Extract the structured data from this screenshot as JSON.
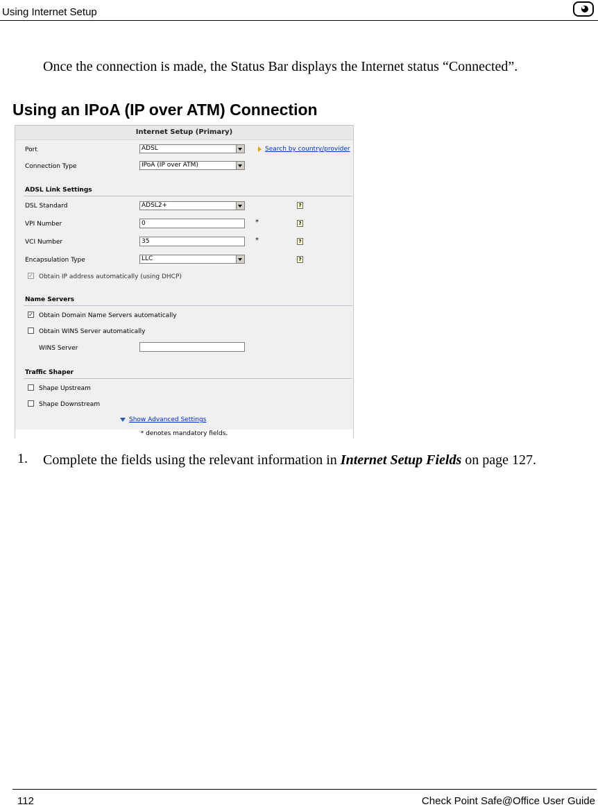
{
  "header": {
    "title": "Using Internet Setup",
    "icon": "device-icon"
  },
  "intro": "Once the connection is made, the Status Bar displays the Internet status “Connected”.",
  "section_title": "Using an IPoA (IP over ATM) Connection",
  "screenshot": {
    "panel_title": "Internet Setup (Primary)",
    "port": {
      "label": "Port",
      "value": "ADSL"
    },
    "search_link": "Search by country/provider",
    "connection_type": {
      "label": "Connection Type",
      "value": "IPoA (IP over ATM)"
    },
    "adsl_section": "ADSL Link Settings",
    "dsl_standard": {
      "label": "DSL Standard",
      "value": "ADSL2+"
    },
    "vpi": {
      "label": "VPI Number",
      "value": "0"
    },
    "vci": {
      "label": "VCI Number",
      "value": "35"
    },
    "encapsulation": {
      "label": "Encapsulation Type",
      "value": "LLC"
    },
    "mandatory_star": "*",
    "obtain_ip": "Obtain IP address automatically (using DHCP)",
    "name_servers_section": "Name Servers",
    "obtain_dns": "Obtain Domain Name Servers automatically",
    "obtain_wins": "Obtain WINS Server automatically",
    "wins_server": {
      "label": "WINS Server",
      "value": ""
    },
    "traffic_section": "Traffic Shaper",
    "shape_up": "Shape Upstream",
    "shape_down": "Shape Downstream",
    "advanced_link": "Show Advanced Settings",
    "mandatory_note": "* denotes mandatory fields.",
    "help_glyph": "?",
    "check_glyph": "✓"
  },
  "step": {
    "number": "1.",
    "text_before": "Complete the fields using the relevant information in ",
    "bold": "Internet Setup Fields",
    "text_after": " on page 127."
  },
  "footer": {
    "page": "112",
    "book": "Check Point Safe@Office User Guide"
  }
}
